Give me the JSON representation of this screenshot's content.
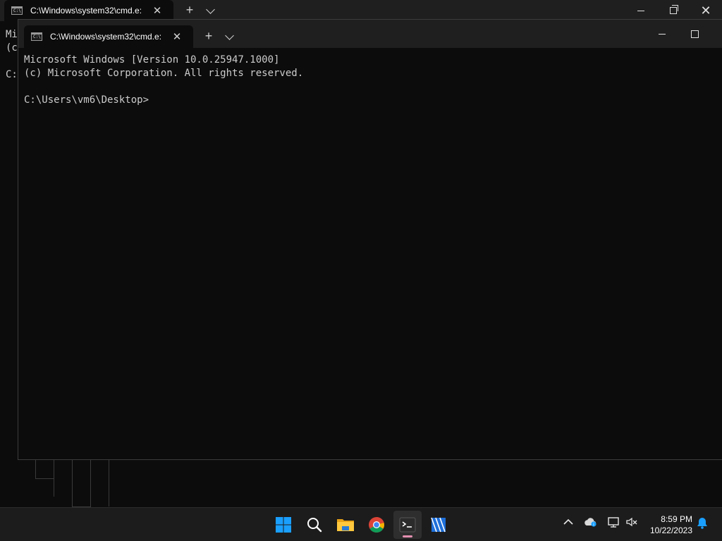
{
  "back_window": {
    "tab_title": "C:\\Windows\\system32\\cmd.e:",
    "tab_icon_text": "C:\\",
    "new_tab_label": "+",
    "partial_lines": [
      "Mi",
      "(c",
      "",
      "C:"
    ]
  },
  "front_window": {
    "tab_title": "C:\\Windows\\system32\\cmd.e:",
    "tab_icon_text": "C:\\",
    "new_tab_label": "+",
    "lines": [
      "Microsoft Windows [Version 10.0.25947.1000]",
      "(c) Microsoft Corporation. All rights reserved.",
      "",
      "C:\\Users\\vm6\\Desktop>"
    ]
  },
  "taskbar": {
    "apps": [
      {
        "name": "start-button",
        "icon": "windows-logo"
      },
      {
        "name": "search-button",
        "icon": "search-icon"
      },
      {
        "name": "file-explorer",
        "icon": "folder-icon"
      },
      {
        "name": "chrome",
        "icon": "chrome-icon"
      },
      {
        "name": "terminal",
        "icon": "terminal-icon",
        "active": true
      },
      {
        "name": "app",
        "icon": "clapperboard-icon"
      }
    ],
    "tray": {
      "chevron": "^",
      "time": "8:59 PM",
      "date": "10/22/2023"
    }
  },
  "colors": {
    "terminal_bg": "#0c0c0c",
    "tabbar_bg": "#1f1f1f",
    "taskbar_bg": "#1c1c1c",
    "active_indicator": "#e48fb0",
    "windows_blue": "#1a9fff"
  }
}
